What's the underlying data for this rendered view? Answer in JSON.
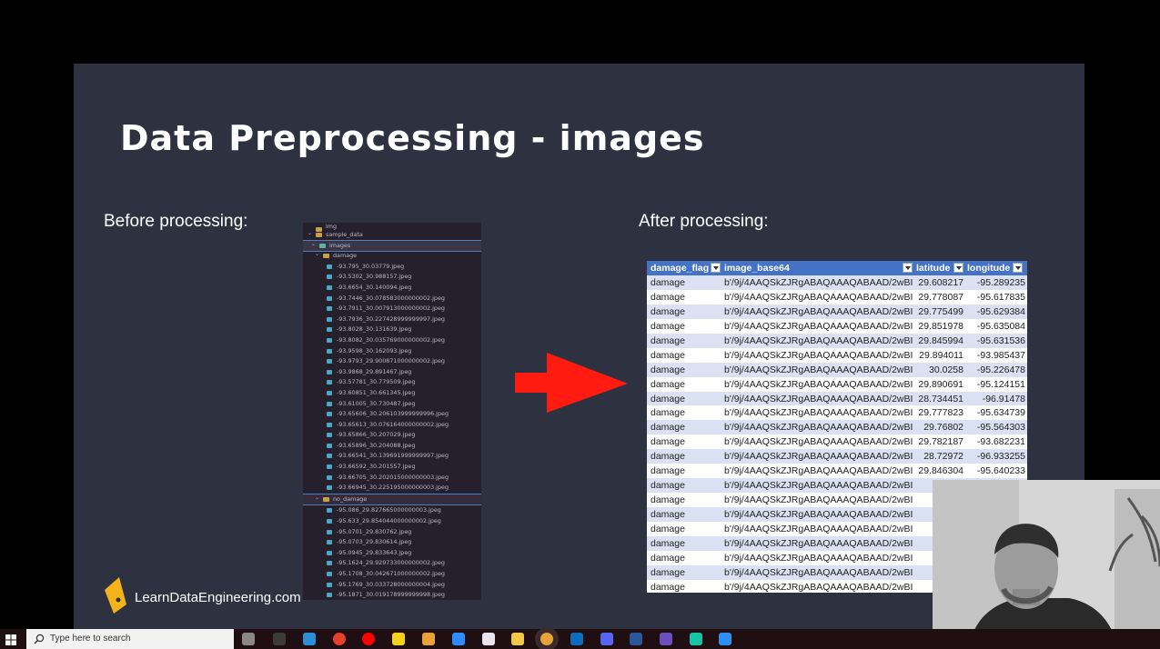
{
  "slide": {
    "title": "Data Preprocessing - images",
    "before_label": "Before processing:",
    "after_label": "After processing:",
    "logo_text": "LearnDataEngineering.com",
    "arrow_color": "#ff1b10"
  },
  "file_tree": {
    "root_partial": "img",
    "sample_folder": "sample_data",
    "images_folder": "images",
    "damage_folder": "damage",
    "damage_files": [
      "-93.795_30.03779.jpeg",
      "-93.5302_30.988157.jpeg",
      "-93.6654_30.140094.jpeg",
      "-93.7446_30.078583000000002.jpeg",
      "-93.7911_30.007913000000002.jpeg",
      "-93.7936_30.227428999999997.jpeg",
      "-93.8028_30.131639.jpeg",
      "-93.8082_30.035769000000002.jpeg",
      "-93.9598_30.162093.jpeg",
      "-93.9793_29.900871000000002.jpeg",
      "-93.9868_29.891467.jpeg",
      "-93.57781_30.779509.jpeg",
      "-93.60851_30.661345.jpeg",
      "-93.61005_30.730487.jpeg",
      "-93.65606_30.206103999999996.jpeg",
      "-93.65613_30.076164000000002.jpeg",
      "-93.65866_30.207029.jpeg",
      "-93.65896_30.204088.jpeg",
      "-93.66541_30.139691999999997.jpeg",
      "-93.66592_30.201557.jpeg",
      "-93.66705_30.202015000000003.jpeg",
      "-93.66945_30.225195000000003.jpeg"
    ],
    "no_damage_folder": "no_damage",
    "no_damage_files": [
      "-95.086_29.827665000000003.jpeg",
      "-95.633_29.854044000000002.jpeg",
      "-95.0701_29.830762.jpeg",
      "-95.0703_29.830614.jpeg",
      "-95.0945_29.833643.jpeg",
      "-95.1624_29.929733000000002.jpeg",
      "-95.1708_30.042671000000002.jpeg",
      "-95.1769_30.033728000000004.jpeg",
      "-95.1871_30.019178999999998.jpeg"
    ]
  },
  "table": {
    "headers": [
      "damage_flag",
      "image_base64",
      "latitude",
      "longitude"
    ],
    "rows": [
      [
        "damage",
        "b'/9j/4AAQSkZJRgABAQAAAQABAAD/2wBI",
        "29.608217",
        "-95.289235"
      ],
      [
        "damage",
        "b'/9j/4AAQSkZJRgABAQAAAQABAAD/2wBI",
        "29.778087",
        "-95.617835"
      ],
      [
        "damage",
        "b'/9j/4AAQSkZJRgABAQAAAQABAAD/2wBI",
        "29.775499",
        "-95.629384"
      ],
      [
        "damage",
        "b'/9j/4AAQSkZJRgABAQAAAQABAAD/2wBI",
        "29.851978",
        "-95.635084"
      ],
      [
        "damage",
        "b'/9j/4AAQSkZJRgABAQAAAQABAAD/2wBI",
        "29.845994",
        "-95.631536"
      ],
      [
        "damage",
        "b'/9j/4AAQSkZJRgABAQAAAQABAAD/2wBI",
        "29.894011",
        "-93.985437"
      ],
      [
        "damage",
        "b'/9j/4AAQSkZJRgABAQAAAQABAAD/2wBI",
        "30.0258",
        "-95.226478"
      ],
      [
        "damage",
        "b'/9j/4AAQSkZJRgABAQAAAQABAAD/2wBI",
        "29.890691",
        "-95.124151"
      ],
      [
        "damage",
        "b'/9j/4AAQSkZJRgABAQAAAQABAAD/2wBI",
        "28.734451",
        "-96.91478"
      ],
      [
        "damage",
        "b'/9j/4AAQSkZJRgABAQAAAQABAAD/2wBI",
        "29.777823",
        "-95.634739"
      ],
      [
        "damage",
        "b'/9j/4AAQSkZJRgABAQAAAQABAAD/2wBI",
        "29.76802",
        "-95.564303"
      ],
      [
        "damage",
        "b'/9j/4AAQSkZJRgABAQAAAQABAAD/2wBI",
        "29.782187",
        "-93.682231"
      ],
      [
        "damage",
        "b'/9j/4AAQSkZJRgABAQAAAQABAAD/2wBI",
        "28.72972",
        "-96.933255"
      ],
      [
        "damage",
        "b'/9j/4AAQSkZJRgABAQAAAQABAAD/2wBI",
        "29.846304",
        "-95.640233"
      ],
      [
        "damage",
        "b'/9j/4AAQSkZJRgABAQAAAQABAAD/2wBI",
        "28.",
        ""
      ],
      [
        "damage",
        "b'/9j/4AAQSkZJRgABAQAAAQABAAD/2wBI",
        "29.",
        ""
      ],
      [
        "damage",
        "b'/9j/4AAQSkZJRgABAQAAAQABAAD/2wBI",
        "28.",
        ""
      ],
      [
        "damage",
        "b'/9j/4AAQSkZJRgABAQAAAQABAAD/2wBI",
        "28.",
        ""
      ],
      [
        "damage",
        "b'/9j/4AAQSkZJRgABAQAAAQABAAD/2wBI",
        "2",
        ""
      ],
      [
        "damage",
        "b'/9j/4AAQSkZJRgABAQAAAQABAAD/2wBI",
        "29.",
        ""
      ],
      [
        "damage",
        "b'/9j/4AAQSkZJRgABAQAAAQABAAD/2wBI",
        "29.",
        ""
      ],
      [
        "damage",
        "b'/9j/4AAQSkZJRgABAQAAAQABAAD/2wBI",
        "30.",
        ""
      ]
    ]
  },
  "taskbar": {
    "search_placeholder": "Type here to search",
    "icons": [
      "task-view-icon",
      "terminal-icon",
      "edge-icon",
      "media-player-icon",
      "youtube-icon",
      "miro-icon",
      "chrome-icon",
      "zoom-icon",
      "slack-icon",
      "file-explorer-icon",
      "chrome-active-icon",
      "edge-dev-icon",
      "discord-icon",
      "word-icon",
      "obs-icon",
      "app-green-icon",
      "vscode-icon"
    ],
    "icon_colors": [
      "#888888",
      "#3b3b3b",
      "#2c8fd6",
      "#e8402f",
      "#ff0000",
      "#f5d31a",
      "#eaa13a",
      "#2d8cff",
      "#e9e3ee",
      "#f2c84b",
      "#e8a23a",
      "#0f6cbd",
      "#5865f2",
      "#2b579a",
      "#6b4fbb",
      "#19c3a5",
      "#2f8ff0"
    ]
  },
  "webcam": {
    "label": "presenter webcam"
  }
}
